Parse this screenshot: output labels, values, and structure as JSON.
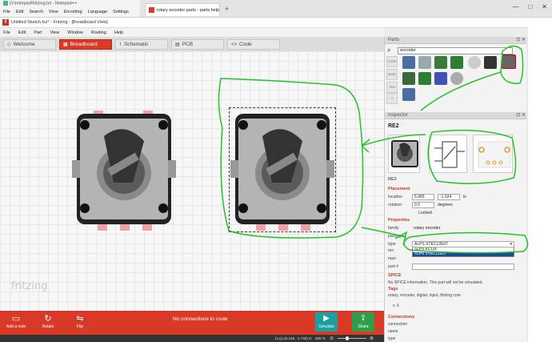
{
  "notepad": {
    "title": "D:\\notepad\\fritzing.txt - Notepad++",
    "menu": [
      "File",
      "Edit",
      "Search",
      "View",
      "Encoding",
      "Language",
      "Settings"
    ]
  },
  "browser": {
    "tab_title": "rotary encoder parts - parts.help",
    "new_tab": "+",
    "controls": [
      "—",
      "□",
      "✕"
    ]
  },
  "app": {
    "title": "Untitled Sketch.fzz* - Fritzing - [Breadboard View]",
    "menu": [
      "File",
      "Edit",
      "Part",
      "View",
      "Window",
      "Routing",
      "Help"
    ],
    "tabs": [
      {
        "label": "Welcome",
        "icon": "welcome-icon"
      },
      {
        "label": "Breadboard",
        "icon": "breadboard-icon",
        "active": true
      },
      {
        "label": "Schematic",
        "icon": "schematic-icon"
      },
      {
        "label": "PCB",
        "icon": "pcb-icon"
      },
      {
        "label": "Code",
        "icon": "code-icon"
      }
    ],
    "watermark": "fritzing",
    "accent": "#d83a27"
  },
  "bottom": {
    "add_note": "Add a note",
    "rotate": "Rotate",
    "flip": "Flip",
    "status": "No connections to route",
    "simulate": "Simulate",
    "share": "Share"
  },
  "statusbar": {
    "coords": "(x,y)=(5.148, -1.740) in",
    "zoom": "685 %"
  },
  "parts": {
    "header": "Parts",
    "search_value": "encoder",
    "bins": [
      "CORE",
      "MINE",
      "SIM",
      "∞"
    ]
  },
  "inspector": {
    "header": "Inspector",
    "title": "RE2",
    "caption": "RE2",
    "placement": {
      "section": "Placement",
      "location_label": "location",
      "location_x": "5.965",
      "location_y": "-1.524",
      "location_unit": "in",
      "rotation_label": "rotation",
      "rotation_value": "0.0",
      "rotation_unit": "degrees",
      "locked": "Locked"
    },
    "properties": {
      "section": "Properties",
      "family_label": "family",
      "family_value": "rotary encoder",
      "package_label": "package",
      "type_label": "type",
      "type_value": "ALPS STEC12E07",
      "type_options": [
        "ALPS EC11E",
        "ALPS STEC12E07"
      ],
      "mn_label": "mn",
      "mpn_label": "mpn",
      "part_label": "part #"
    },
    "spice": {
      "section": "SPICE",
      "text": "No SPICE information. This part will not be simulated."
    },
    "tags": {
      "section": "Tags",
      "text": "rotary, encoder, digital, input, fritzing core"
    },
    "version": "v. 5",
    "connections": {
      "section": "Connections",
      "rows": [
        "connection",
        "name",
        "type"
      ]
    }
  }
}
